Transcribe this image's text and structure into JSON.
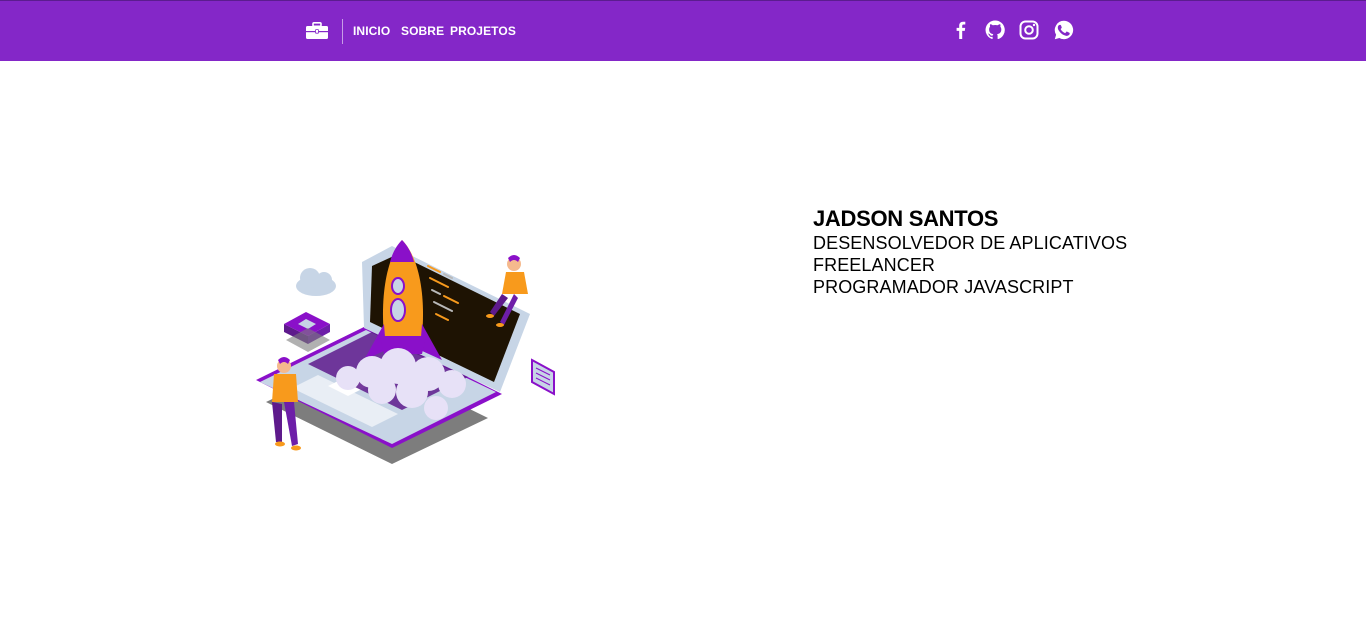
{
  "nav": {
    "brand_icon": "briefcase-icon",
    "links": [
      {
        "label": "INICIO"
      },
      {
        "label": "SOBRE"
      },
      {
        "label": "PROJETOS"
      }
    ],
    "social_icons": [
      "facebook-icon",
      "github-icon",
      "instagram-icon",
      "whatsapp-icon"
    ]
  },
  "hero": {
    "illustration": "rocket-laptop-illustration"
  },
  "profile": {
    "name": "JADSON SANTOS",
    "roles": [
      "DESENSOLVEDOR DE APLICATIVOS",
      "FREELANCER",
      "PROGRAMADOR JAVASCRIPT"
    ]
  },
  "colors": {
    "navbar": "#8427c8",
    "accent_orange": "#f89a1c",
    "accent_purple": "#8a10c9"
  }
}
